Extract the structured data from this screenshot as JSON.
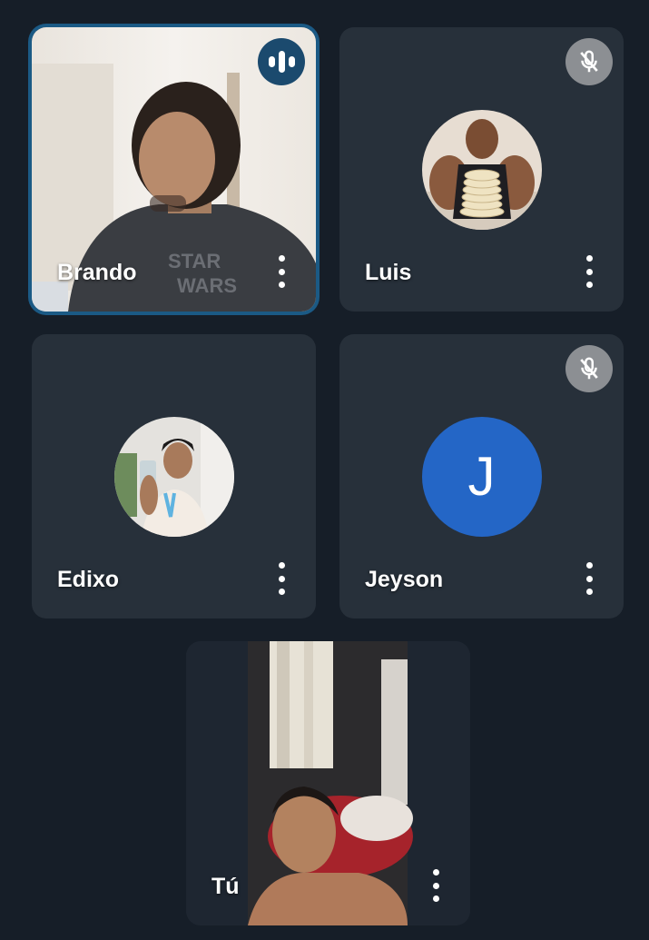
{
  "participants": [
    {
      "name": "Brando",
      "speaking": true,
      "muted": false,
      "icon": "audio-activity-icon"
    },
    {
      "name": "Luis",
      "speaking": false,
      "muted": true,
      "icon": "mic-off-icon"
    },
    {
      "name": "Edixo",
      "speaking": false,
      "muted": false
    },
    {
      "name": "Jeyson",
      "speaking": false,
      "muted": true,
      "icon": "mic-off-icon",
      "avatar_letter": "J",
      "avatar_color": "#2466c6"
    },
    {
      "name": "Tú",
      "speaking": false,
      "muted": false
    }
  ],
  "colors": {
    "background": "#161e28",
    "tile": "#27303a",
    "speaking_border": "#1b5a85"
  }
}
